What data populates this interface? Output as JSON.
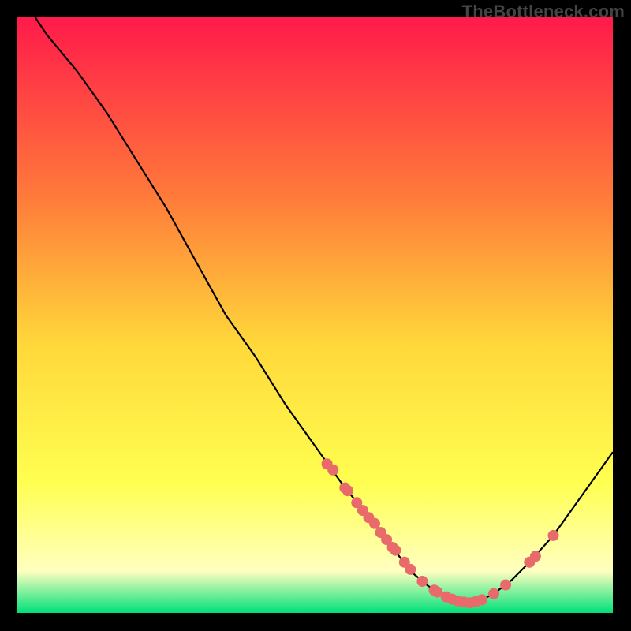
{
  "watermark": "TheBottleneck.com",
  "chart_data": {
    "type": "line",
    "xlim": [
      0,
      100
    ],
    "ylim": [
      0,
      100
    ],
    "title": "",
    "xlabel": "",
    "ylabel": "",
    "background_gradient": {
      "top": "#ff1a4a",
      "mid1": "#ff7a3a",
      "mid2": "#ffd83a",
      "mid3": "#ffff50",
      "mid4": "#ffffc0",
      "bottom": "#00e07a"
    },
    "curve": [
      {
        "x": 3,
        "y": 100
      },
      {
        "x": 5,
        "y": 97
      },
      {
        "x": 10,
        "y": 91
      },
      {
        "x": 15,
        "y": 84
      },
      {
        "x": 20,
        "y": 76
      },
      {
        "x": 25,
        "y": 68
      },
      {
        "x": 30,
        "y": 59
      },
      {
        "x": 35,
        "y": 50
      },
      {
        "x": 40,
        "y": 43
      },
      {
        "x": 45,
        "y": 35
      },
      {
        "x": 50,
        "y": 28
      },
      {
        "x": 55,
        "y": 21
      },
      {
        "x": 60,
        "y": 15
      },
      {
        "x": 63,
        "y": 11
      },
      {
        "x": 66,
        "y": 7
      },
      {
        "x": 69,
        "y": 4.5
      },
      {
        "x": 72,
        "y": 2.7
      },
      {
        "x": 74,
        "y": 2.0
      },
      {
        "x": 76,
        "y": 1.7
      },
      {
        "x": 78,
        "y": 2.2
      },
      {
        "x": 80,
        "y": 3.2
      },
      {
        "x": 83,
        "y": 5.5
      },
      {
        "x": 86,
        "y": 8.5
      },
      {
        "x": 90,
        "y": 13
      },
      {
        "x": 95,
        "y": 20
      },
      {
        "x": 100,
        "y": 27
      }
    ],
    "markers": [
      {
        "x": 52,
        "y": 25
      },
      {
        "x": 53,
        "y": 24
      },
      {
        "x": 55,
        "y": 21
      },
      {
        "x": 55.5,
        "y": 20.5
      },
      {
        "x": 57,
        "y": 18.5
      },
      {
        "x": 58,
        "y": 17.2
      },
      {
        "x": 59,
        "y": 16
      },
      {
        "x": 60,
        "y": 15
      },
      {
        "x": 61,
        "y": 13.5
      },
      {
        "x": 62,
        "y": 12.3
      },
      {
        "x": 63,
        "y": 11
      },
      {
        "x": 63.5,
        "y": 10.5
      },
      {
        "x": 65,
        "y": 8.5
      },
      {
        "x": 66,
        "y": 7.3
      },
      {
        "x": 68,
        "y": 5.3
      },
      {
        "x": 70,
        "y": 3.8
      },
      {
        "x": 70.5,
        "y": 3.5
      },
      {
        "x": 72,
        "y": 2.7
      },
      {
        "x": 73,
        "y": 2.3
      },
      {
        "x": 74,
        "y": 2.0
      },
      {
        "x": 75,
        "y": 1.8
      },
      {
        "x": 76,
        "y": 1.7
      },
      {
        "x": 77,
        "y": 1.9
      },
      {
        "x": 78,
        "y": 2.2
      },
      {
        "x": 80,
        "y": 3.2
      },
      {
        "x": 82,
        "y": 4.7
      },
      {
        "x": 86,
        "y": 8.5
      },
      {
        "x": 87,
        "y": 9.5
      },
      {
        "x": 90,
        "y": 13
      }
    ]
  }
}
